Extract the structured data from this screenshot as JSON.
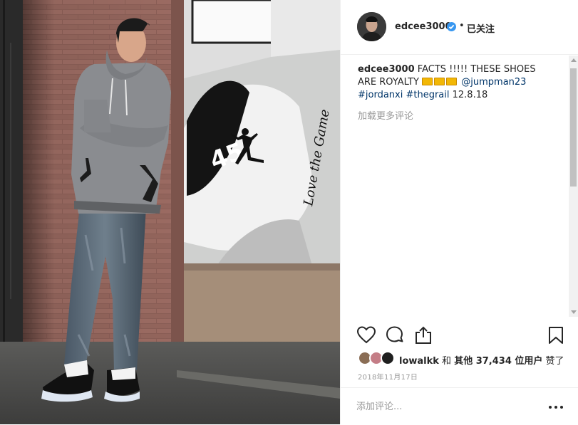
{
  "post": {
    "author": {
      "username": "edcee3000",
      "verified": true,
      "separator": "•",
      "follow_label": "已关注"
    },
    "caption": {
      "username": "edcee3000",
      "text_main": " FACTS !!!!! THESE SHOES ARE ROYALTY ",
      "emoji": [
        "crown",
        "crown",
        "crown"
      ],
      "mention": "@jumpman23",
      "hashtag_1": "#jordanxi",
      "hashtag_2": "#thegrail",
      "text_end": " 12.8.18"
    },
    "load_more_label": "加载更多评论",
    "likes": {
      "user": "lowalkk",
      "connector": " 和 ",
      "others_label": "其他 37,434 位用户",
      "suffix": " 赞了"
    },
    "date": "2018年11月17日",
    "comment_input": {
      "placeholder": "添加评论..."
    },
    "icons": {
      "like": "heart-icon",
      "comment": "comment-icon",
      "share": "share-icon",
      "save": "bookmark-icon",
      "more": "more-options-icon",
      "verified": "verified-badge-icon"
    },
    "colors": {
      "link": "#003569",
      "verified": "#3897f0",
      "muted": "#999999",
      "text": "#262626"
    },
    "photo_poster_text": "Love the Game",
    "photo_poster_number": "45"
  }
}
